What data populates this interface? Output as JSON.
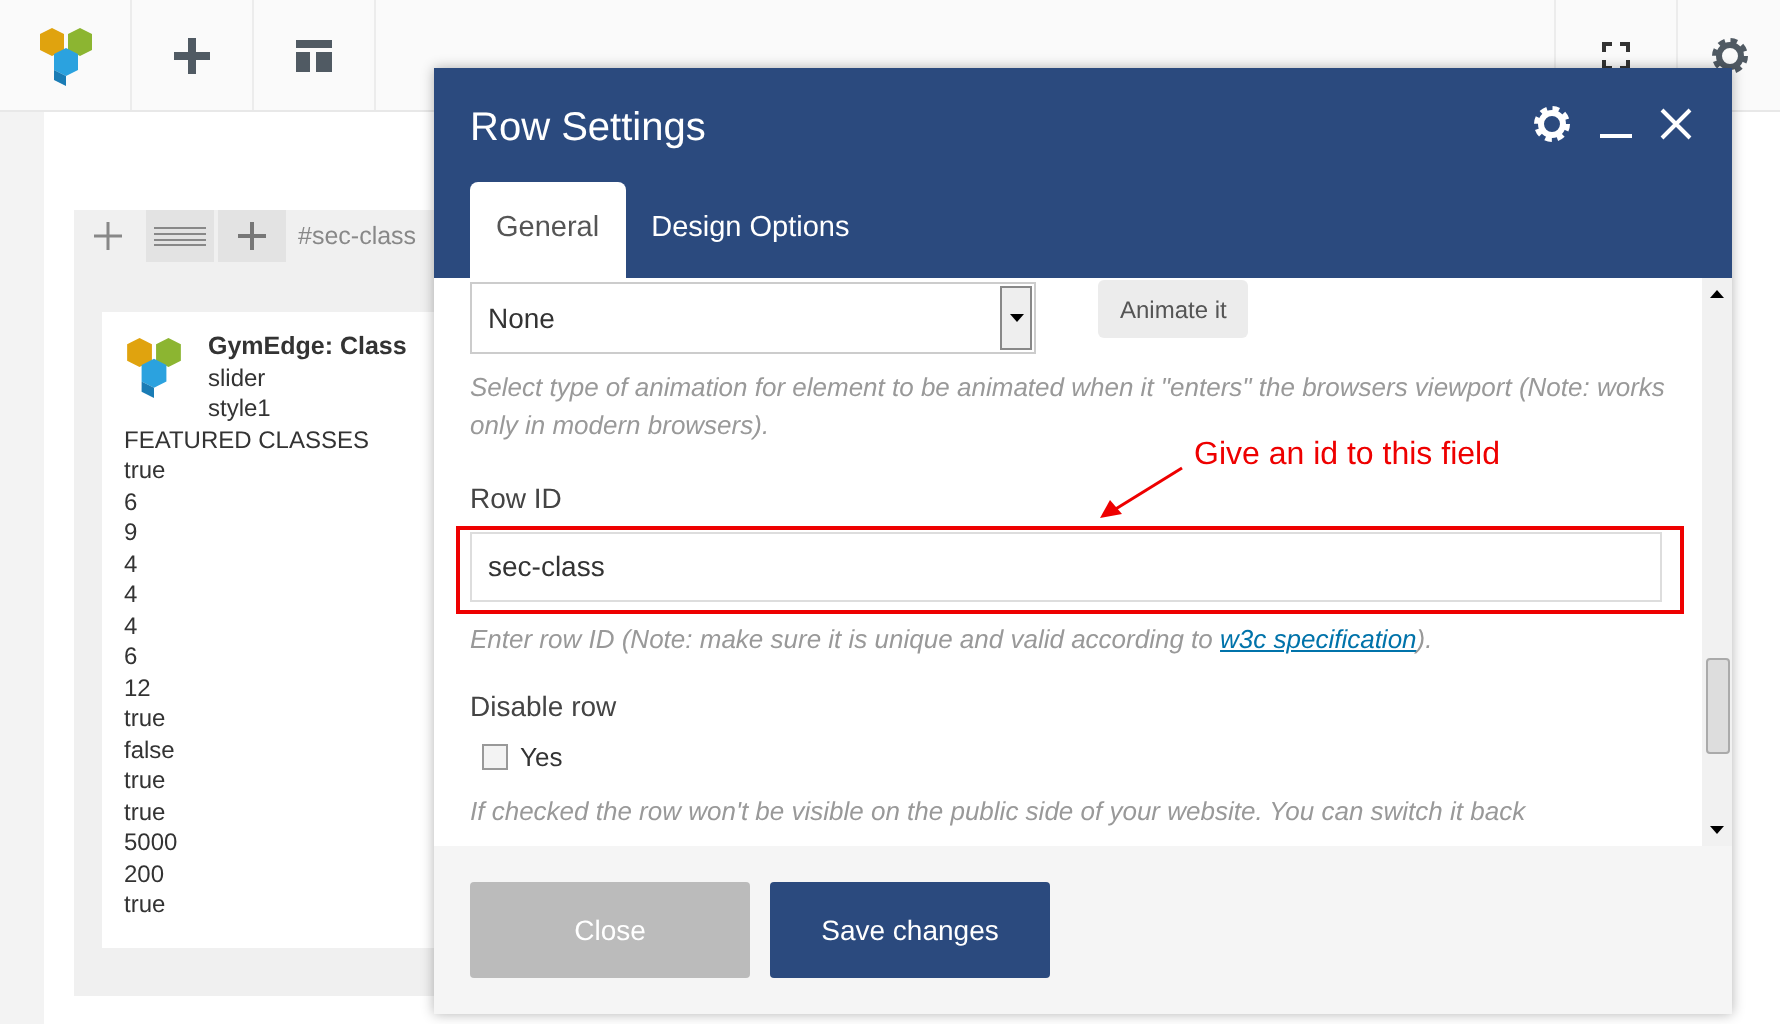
{
  "row_controls": {
    "label": "#sec-class"
  },
  "element": {
    "title": "GymEdge: Class",
    "subtitle_lines": [
      "slider",
      "style1"
    ],
    "lines": [
      "FEATURED CLASSES",
      "true",
      "6",
      "9",
      "4",
      "4",
      "4",
      "6",
      "12",
      "true",
      "false",
      "true",
      "true",
      "5000",
      "200",
      "true"
    ]
  },
  "modal": {
    "title": "Row Settings",
    "tabs": [
      {
        "label": "General",
        "selected": true
      },
      {
        "label": "Design Options",
        "selected": false
      }
    ],
    "animation": {
      "select_value": "None",
      "button": "Animate it",
      "help": "Select type of animation for element to be animated when it \"enters\" the browsers viewport (Note: works only in modern browsers)."
    },
    "row_id": {
      "label": "Row ID",
      "value": "sec-class",
      "help_before": "Enter row ID (Note: make sure it is unique and valid according to ",
      "help_link": "w3c specification",
      "help_after": ")."
    },
    "disable_row": {
      "label": "Disable row",
      "option": "Yes",
      "checked": false,
      "help": "If checked the row won't be visible on the public side of your website. You can switch it back"
    },
    "buttons": [
      {
        "label": "Close",
        "kind": "secondary"
      },
      {
        "label": "Save changes",
        "kind": "primary"
      }
    ]
  },
  "annotation": {
    "text": "Give an id to this field"
  }
}
